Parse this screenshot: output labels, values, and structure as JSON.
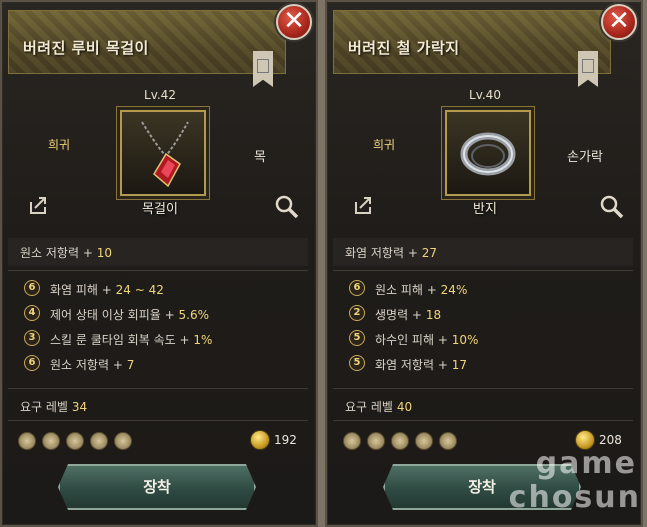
{
  "colors": {
    "accent_gold": "#f0d47a",
    "equip_button": "#2f4b43",
    "close_red": "#a8261c"
  },
  "left": {
    "title": "버려진 루비 목걸이",
    "level": "Lv.42",
    "rarity": "희귀",
    "slot": "목",
    "item_type": "목걸이",
    "item_icon": "ruby-necklace-icon",
    "base_stat": {
      "label": "원소 저항력 + ",
      "value": "10"
    },
    "stats": [
      {
        "badge": "6",
        "label": "화염 피해 + ",
        "value": "24 ~ 42"
      },
      {
        "badge": "4",
        "label": "제어 상태 이상 회피율 + ",
        "value": "5.6%"
      },
      {
        "badge": "3",
        "label": "스킬 룬 쿨타임 회복 속도 + ",
        "value": "1%"
      },
      {
        "badge": "6",
        "label": "원소 저항력 + ",
        "value": "7"
      }
    ],
    "requirement": {
      "label": "요구 레벨",
      "value": "34"
    },
    "gold": "192",
    "equip_label": "장착"
  },
  "right": {
    "title": "버려진 철 가락지",
    "level": "Lv.40",
    "rarity": "희귀",
    "slot": "손가락",
    "item_type": "반지",
    "item_icon": "iron-ring-icon",
    "base_stat": {
      "label": "화염 저항력 + ",
      "value": "27"
    },
    "stats": [
      {
        "badge": "6",
        "label": "원소 피해 + ",
        "value": "24%"
      },
      {
        "badge": "2",
        "label": "생명력 + ",
        "value": "18"
      },
      {
        "badge": "5",
        "label": "하수인 피해 + ",
        "value": "10%"
      },
      {
        "badge": "5",
        "label": "화염 저항력 + ",
        "value": "17"
      }
    ],
    "requirement": {
      "label": "요구 레벨",
      "value": "40"
    },
    "gold": "208",
    "equip_label": "장착"
  },
  "watermark": {
    "line1": "game",
    "line2": "chosun"
  }
}
